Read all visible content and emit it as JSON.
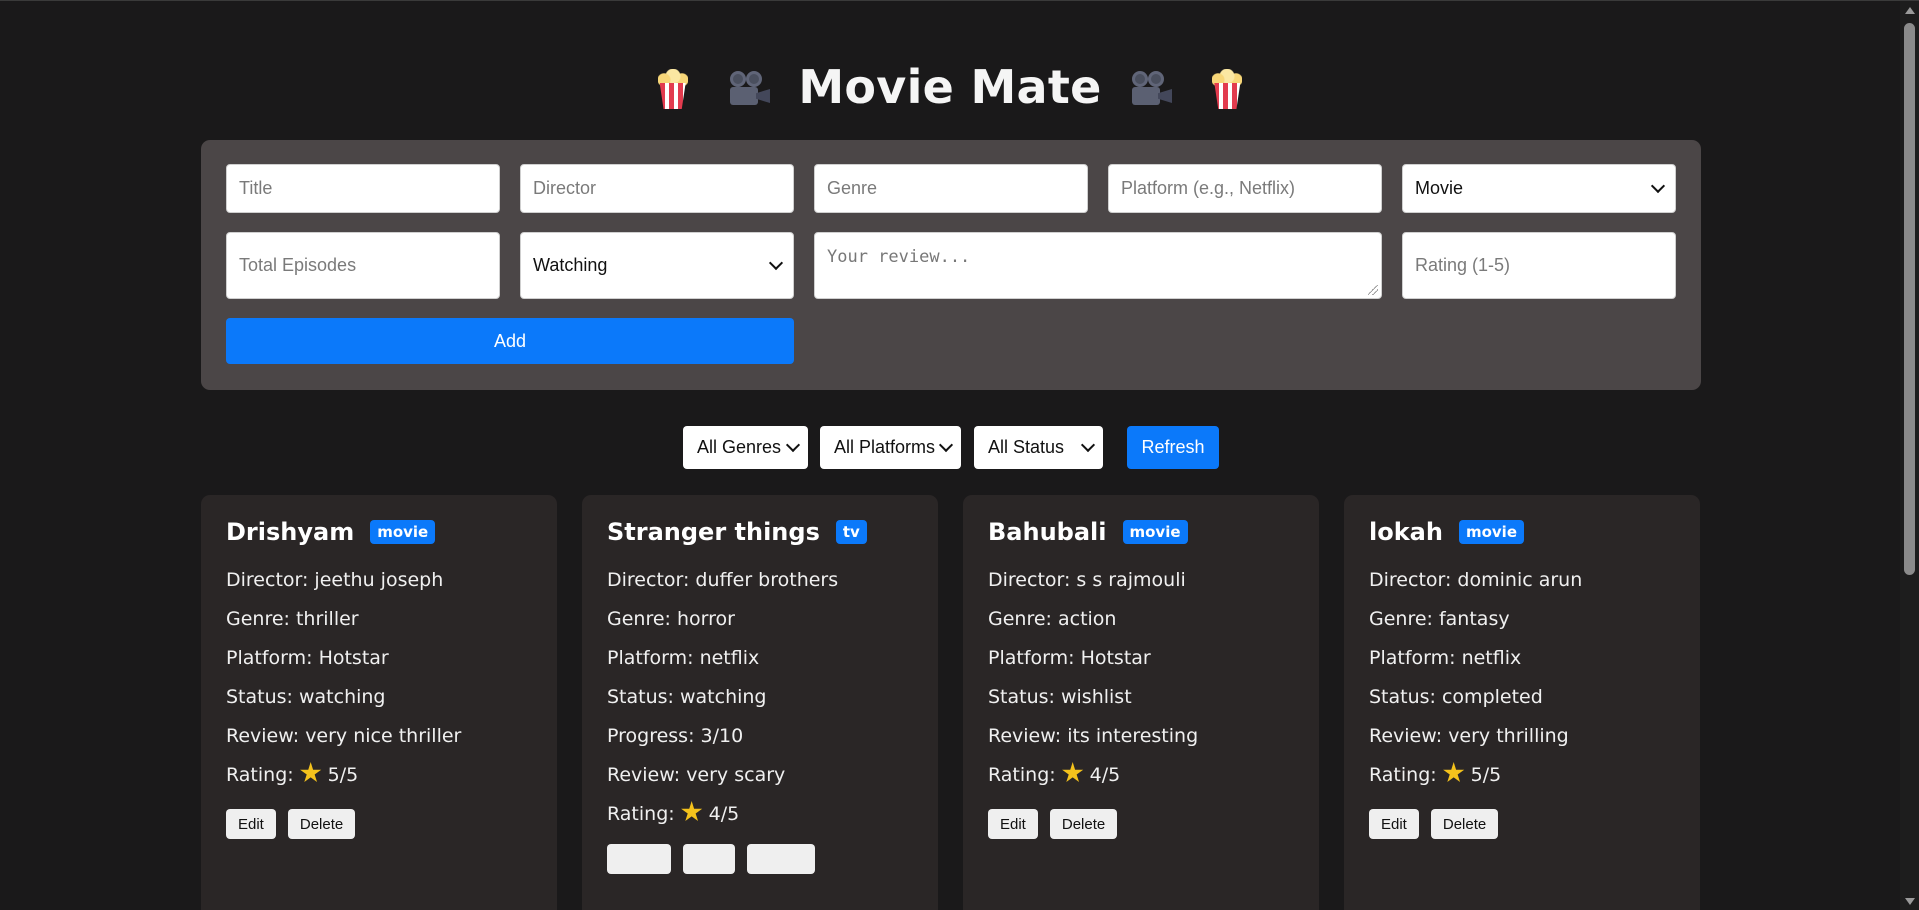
{
  "app": {
    "title": "Movie Mate",
    "icons": [
      "popcorn-icon",
      "movie-camera-icon",
      "movie-camera-icon",
      "popcorn-icon"
    ]
  },
  "form": {
    "title_placeholder": "Title",
    "director_placeholder": "Director",
    "genre_placeholder": "Genre",
    "platform_placeholder": "Platform (e.g., Netflix)",
    "type_value": "Movie",
    "episodes_placeholder": "Total Episodes",
    "status_value": "Watching",
    "review_placeholder": "Your review...",
    "rating_placeholder": "Rating (1-5)",
    "add_label": "Add"
  },
  "filters": {
    "genre_value": "All Genres",
    "platform_value": "All Platforms",
    "status_value": "All Status",
    "refresh_label": "Refresh"
  },
  "colors": {
    "accent": "#0b79fa",
    "background": "#1a191a",
    "panel": "#4b4647",
    "card": "#2a2626",
    "star": "#f4c21c"
  },
  "cards": [
    {
      "title": "Drishyam",
      "badge": "movie",
      "director": "Director: jeethu joseph",
      "genre": "Genre: thriller",
      "platform": "Platform: Hotstar",
      "status": "Status: watching",
      "review": "Review: very nice thriller",
      "rating_label": "Rating:",
      "rating": "5/5",
      "edit": "Edit",
      "delete": "Delete"
    },
    {
      "title": "Stranger things",
      "badge": "tv",
      "director": "Director: duffer brothers",
      "genre": "Genre: horror",
      "platform": "Platform: netflix",
      "status": "Status: watching",
      "progress": "Progress: 3/10",
      "review": "Review: very scary",
      "rating_label": "Rating:",
      "rating": "4/5"
    },
    {
      "title": "Bahubali",
      "badge": "movie",
      "director": "Director: s s rajmouli",
      "genre": "Genre: action",
      "platform": "Platform: Hotstar",
      "status": "Status: wishlist",
      "review": "Review: its interesting",
      "rating_label": "Rating:",
      "rating": "4/5",
      "edit": "Edit",
      "delete": "Delete"
    },
    {
      "title": "lokah",
      "badge": "movie",
      "director": "Director: dominic arun",
      "genre": "Genre: fantasy",
      "platform": "Platform: netflix",
      "status": "Status: completed",
      "review": "Review: very thrilling",
      "rating_label": "Rating:",
      "rating": "5/5",
      "edit": "Edit",
      "delete": "Delete"
    }
  ]
}
